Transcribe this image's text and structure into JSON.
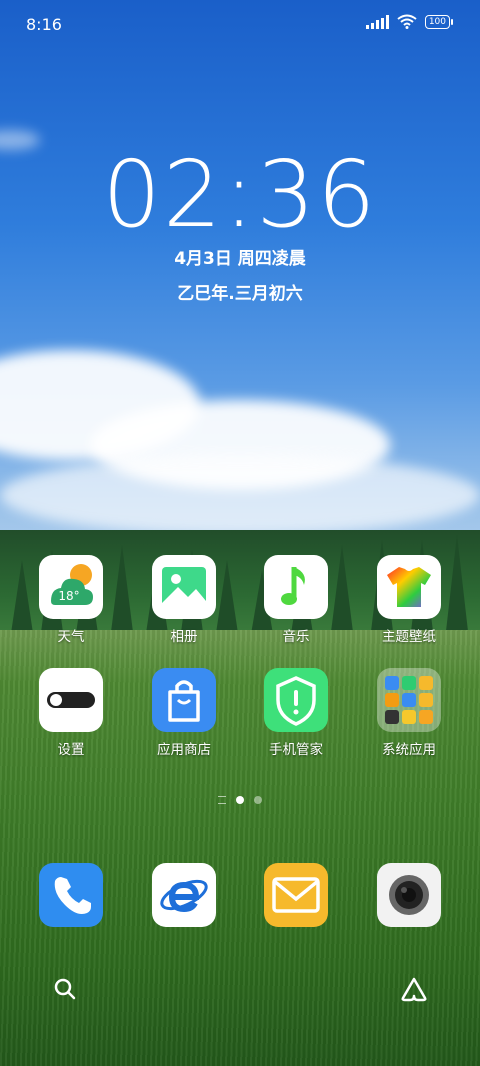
{
  "status_bar": {
    "time": "8:16",
    "battery": "100"
  },
  "clock": {
    "time": "02:36",
    "date": "4月3日 周四凌晨",
    "lunar": "乙巳年.三月初六"
  },
  "weather_temp": "18°",
  "apps": {
    "weather": "天气",
    "gallery": "相册",
    "music": "音乐",
    "themes": "主题壁纸",
    "settings": "设置",
    "app_store": "应用商店",
    "phone_manager": "手机管家",
    "system_apps": "系统应用"
  },
  "page_indicator": {
    "current": 1
  },
  "dock": [
    "phone",
    "browser",
    "email",
    "camera"
  ],
  "colors": {
    "phone": "#2f8df0",
    "app_store": "#3a8cf2",
    "phone_manager": "#3ee07a",
    "email": "#f6b92c",
    "music": "#4fd83f"
  }
}
